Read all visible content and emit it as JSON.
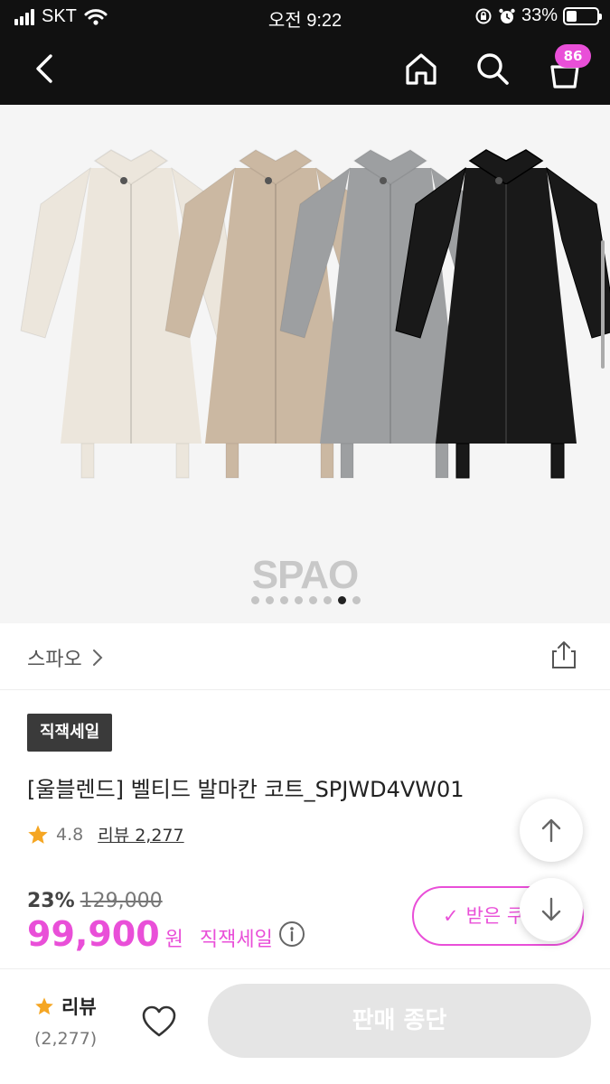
{
  "status_bar": {
    "carrier": "SKT",
    "time": "오전 9:22",
    "battery": "33%",
    "battery_level": 0.33,
    "icons": [
      "signal-icon",
      "wifi-icon",
      "rotation-lock-icon",
      "alarm-icon",
      "battery-icon"
    ]
  },
  "nav": {
    "icons": [
      "back-arrow-icon",
      "home-icon",
      "search-icon",
      "cart-icon"
    ],
    "cart_count": "86",
    "colors": {
      "bar": "#111111",
      "badge": "#e94fd8"
    }
  },
  "gallery": {
    "watermark": "SPAO",
    "total_images": 8,
    "active_index": 6,
    "coat_colors": [
      "#ece6dc",
      "#cbb8a2",
      "#9d9fa1",
      "#191919"
    ]
  },
  "brand": {
    "name": "스파오",
    "icons": [
      "chevron-right-icon",
      "share-icon"
    ]
  },
  "product": {
    "badge": "직잭세일",
    "title": "[울블렌드] 벨티드 발마칸 코트_SPJWD4VW01",
    "rating": "4.8",
    "review_label": "리뷰 2,277",
    "discount": "23%",
    "original_price": "129,000",
    "price": "99,900",
    "currency": "원",
    "sale_label": "직잭세일",
    "coupon_label": "받은 쿠",
    "accent_color": "#e94fd8"
  },
  "bottom_bar": {
    "review_label": "리뷰",
    "review_count": "(2,277)",
    "buy_label": "판매 종단"
  }
}
